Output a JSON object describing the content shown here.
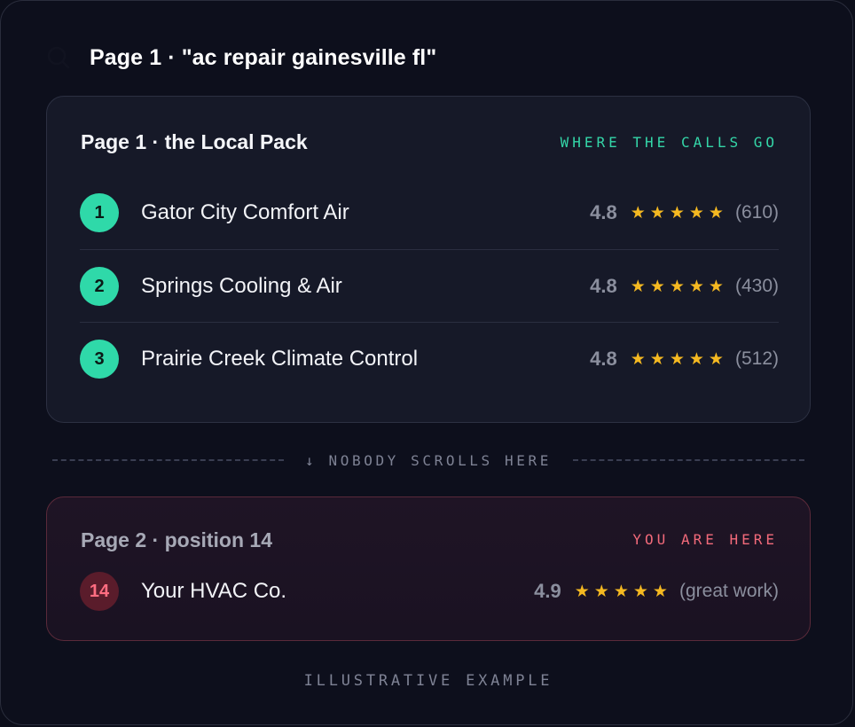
{
  "query": {
    "icon": "search-icon",
    "text": "Page 1 · \"ac repair gainesville fl\""
  },
  "local_pack": {
    "title": "Page 1 · the Local Pack",
    "tag": "WHERE THE CALLS GO",
    "accent": "#2fd9a9",
    "items": [
      {
        "rank": "1",
        "name": "Gator City Comfort Air",
        "score": "4.8",
        "stars": 5,
        "count": "(610)"
      },
      {
        "rank": "2",
        "name": "Springs Cooling & Air",
        "score": "4.8",
        "stars": 5,
        "count": "(430)"
      },
      {
        "rank": "3",
        "name": "Prairie Creek Climate Control",
        "score": "4.8",
        "stars": 5,
        "count": "(512)"
      }
    ]
  },
  "divider": {
    "arrow": "↓",
    "label": "NOBODY SCROLLS HERE"
  },
  "your_listing": {
    "title": "Page 2 · position 14",
    "tag": "YOU ARE HERE",
    "accent": "#f26a7a",
    "rank": "14",
    "name": "Your HVAC Co.",
    "score": "4.9",
    "stars": 5,
    "note": "(great work)"
  },
  "footer": "ILLUSTRATIVE EXAMPLE",
  "colors": {
    "star": "#f5b921",
    "background": "#0d0f1c"
  }
}
